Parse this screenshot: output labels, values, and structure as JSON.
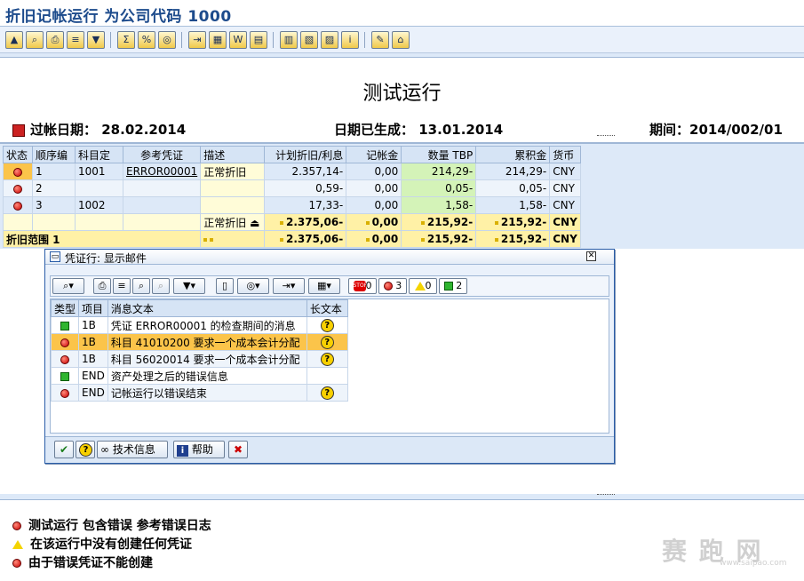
{
  "window": {
    "title": "折旧记帐运行 为公司代码 1000"
  },
  "toolbar": {
    "icons": [
      "select-icon",
      "find-icon",
      "print-icon",
      "sort-icon",
      "filter-icon",
      "sum-icon",
      "subtotal-icon",
      "view-icon",
      "export-icon",
      "spreadsheet-icon",
      "word-icon",
      "local-file-icon",
      "layout-icon",
      "choose-layout-icon",
      "save-layout-icon",
      "info-icon",
      "abap-icon",
      "display-log-icon"
    ]
  },
  "report": {
    "title": "测试运行",
    "posting_date_label": "过帐日期：",
    "posting_date": "28.02.2014",
    "generated_label": "日期已生成：",
    "generated": "13.01.2014",
    "period_label": "期间：",
    "period": "2014/002/01"
  },
  "grid": {
    "headers": [
      "状态",
      "顺序编",
      "科目定",
      "参考凭证",
      "描述",
      "计划折旧/利息",
      "记帐金",
      "数量 TBP",
      "累积金",
      "货币"
    ],
    "rows": [
      {
        "seq": "1",
        "acct": "1001",
        "ref": "ERROR00001",
        "desc": "正常折旧",
        "planned": "2.357,14-",
        "posted": "0,00",
        "tbp": "214,29-",
        "cum": "214,29-",
        "cur": "CNY"
      },
      {
        "seq": "2",
        "acct": "",
        "ref": "",
        "desc": "",
        "planned": "0,59-",
        "posted": "0,00",
        "tbp": "0,05-",
        "cum": "0,05-",
        "cur": "CNY"
      },
      {
        "seq": "3",
        "acct": "1002",
        "ref": "",
        "desc": "",
        "planned": "17,33-",
        "posted": "0,00",
        "tbp": "1,58-",
        "cum": "1,58-",
        "cur": "CNY"
      }
    ],
    "subtotal": {
      "desc": "正常折旧",
      "planned": "2.375,06-",
      "posted": "0,00",
      "tbp": "215,92-",
      "cum": "215,92-",
      "cur": "CNY"
    },
    "total": {
      "label": "折旧范围 1",
      "planned": "2.375,06-",
      "posted": "0,00",
      "tbp": "215,92-",
      "cum": "215,92-",
      "cur": "CNY"
    }
  },
  "popup": {
    "title": "凭证行: 显示邮件",
    "counts": {
      "stop": "0",
      "error": "3",
      "warning": "0",
      "success": "2"
    },
    "headers": [
      "类型",
      "项目",
      "消息文本",
      "长文本"
    ],
    "rows": [
      {
        "type": "success",
        "item": "1B",
        "text": "凭证 ERROR00001 的检查期间的消息",
        "long": true
      },
      {
        "type": "error",
        "item": "1B",
        "text": "科目 41010200 要求一个成本会计分配",
        "long": true
      },
      {
        "type": "error",
        "item": "1B",
        "text": "科目 56020014 要求一个成本会计分配",
        "long": true
      },
      {
        "type": "success",
        "item": "END",
        "text": "资产处理之后的错误信息",
        "long": false
      },
      {
        "type": "error",
        "item": "END",
        "text": "记帐运行以错误结束",
        "long": true
      }
    ],
    "buttons": {
      "tech_info": "技术信息",
      "help": "帮助"
    }
  },
  "status": {
    "lines": [
      {
        "icon": "error",
        "text": "测试运行  包含错误  参考错误日志"
      },
      {
        "icon": "warning",
        "text": "在该运行中没有创建任何凭证"
      },
      {
        "icon": "error",
        "text": "由于错误凭证不能创建"
      }
    ]
  },
  "watermark": {
    "text": "赛 跑 网",
    "url": "www.saipao.com"
  }
}
